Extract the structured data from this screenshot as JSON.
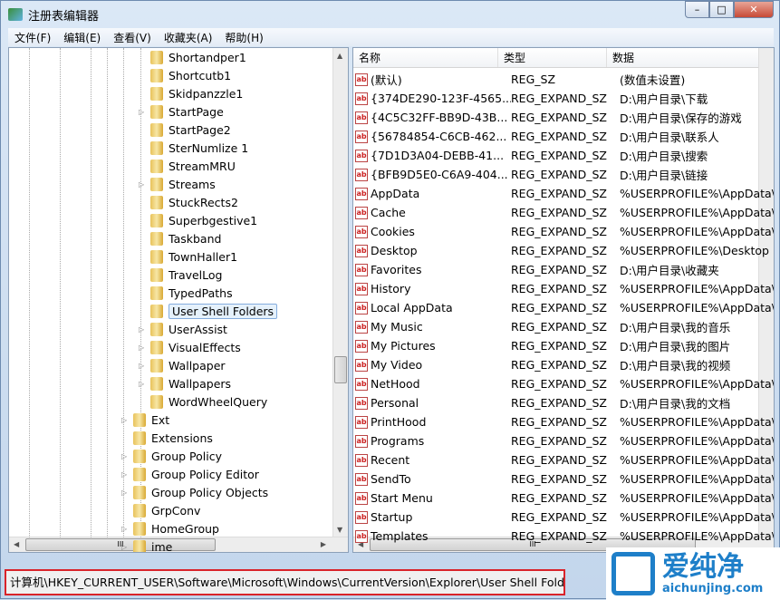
{
  "window": {
    "title": "注册表编辑器",
    "controls": [
      "minimize",
      "maximize",
      "close"
    ]
  },
  "menu": [
    "文件(F)",
    "编辑(E)",
    "查看(V)",
    "收藏夹(A)",
    "帮助(H)"
  ],
  "tree": {
    "deep": [
      {
        "label": "Shortandper1",
        "expandable": false
      },
      {
        "label": "Shortcutb1",
        "expandable": false
      },
      {
        "label": "Skidpanzzle1",
        "expandable": false
      },
      {
        "label": "StartPage",
        "expandable": true
      },
      {
        "label": "StartPage2",
        "expandable": false
      },
      {
        "label": "SterNumlize 1",
        "expandable": false
      },
      {
        "label": "StreamMRU",
        "expandable": false
      },
      {
        "label": "Streams",
        "expandable": true
      },
      {
        "label": "StuckRects2",
        "expandable": false
      },
      {
        "label": "Superbgestive1",
        "expandable": false
      },
      {
        "label": "Taskband",
        "expandable": false
      },
      {
        "label": "TownHaller1",
        "expandable": false
      },
      {
        "label": "TravelLog",
        "expandable": false
      },
      {
        "label": "TypedPaths",
        "expandable": false
      },
      {
        "label": "User Shell Folders",
        "expandable": false,
        "selected": true
      },
      {
        "label": "UserAssist",
        "expandable": true
      },
      {
        "label": "VisualEffects",
        "expandable": true
      },
      {
        "label": "Wallpaper",
        "expandable": true
      },
      {
        "label": "Wallpapers",
        "expandable": true
      },
      {
        "label": "WordWheelQuery",
        "expandable": false
      }
    ],
    "upper": [
      {
        "label": "Ext",
        "expandable": true
      },
      {
        "label": "Extensions",
        "expandable": false
      },
      {
        "label": "Group Policy",
        "expandable": true
      },
      {
        "label": "Group Policy Editor",
        "expandable": true
      },
      {
        "label": "Group Policy Objects",
        "expandable": true
      },
      {
        "label": "GrpConv",
        "expandable": false
      },
      {
        "label": "HomeGroup",
        "expandable": true
      },
      {
        "label": "ime",
        "expandable": true
      }
    ]
  },
  "list": {
    "headers": [
      "名称",
      "类型",
      "数据"
    ],
    "rows": [
      [
        "(默认)",
        "REG_SZ",
        "(数值未设置)"
      ],
      [
        "{374DE290-123F-4565...",
        "REG_EXPAND_SZ",
        "D:\\用户目录\\下载"
      ],
      [
        "{4C5C32FF-BB9D-43B...",
        "REG_EXPAND_SZ",
        "D:\\用户目录\\保存的游戏"
      ],
      [
        "{56784854-C6CB-462...",
        "REG_EXPAND_SZ",
        "D:\\用户目录\\联系人"
      ],
      [
        "{7D1D3A04-DEBB-41...",
        "REG_EXPAND_SZ",
        "D:\\用户目录\\搜索"
      ],
      [
        "{BFB9D5E0-C6A9-404...",
        "REG_EXPAND_SZ",
        "D:\\用户目录\\链接"
      ],
      [
        "AppData",
        "REG_EXPAND_SZ",
        "%USERPROFILE%\\AppData\\Rc"
      ],
      [
        "Cache",
        "REG_EXPAND_SZ",
        "%USERPROFILE%\\AppData\\Lo"
      ],
      [
        "Cookies",
        "REG_EXPAND_SZ",
        "%USERPROFILE%\\AppData\\Rc"
      ],
      [
        "Desktop",
        "REG_EXPAND_SZ",
        "%USERPROFILE%\\Desktop"
      ],
      [
        "Favorites",
        "REG_EXPAND_SZ",
        "D:\\用户目录\\收藏夹"
      ],
      [
        "History",
        "REG_EXPAND_SZ",
        "%USERPROFILE%\\AppData\\Lo"
      ],
      [
        "Local AppData",
        "REG_EXPAND_SZ",
        "%USERPROFILE%\\AppData\\Lo"
      ],
      [
        "My Music",
        "REG_EXPAND_SZ",
        "D:\\用户目录\\我的音乐"
      ],
      [
        "My Pictures",
        "REG_EXPAND_SZ",
        "D:\\用户目录\\我的图片"
      ],
      [
        "My Video",
        "REG_EXPAND_SZ",
        "D:\\用户目录\\我的视频"
      ],
      [
        "NetHood",
        "REG_EXPAND_SZ",
        "%USERPROFILE%\\AppData\\Rc"
      ],
      [
        "Personal",
        "REG_EXPAND_SZ",
        "D:\\用户目录\\我的文档"
      ],
      [
        "PrintHood",
        "REG_EXPAND_SZ",
        "%USERPROFILE%\\AppData\\Rc"
      ],
      [
        "Programs",
        "REG_EXPAND_SZ",
        "%USERPROFILE%\\AppData\\Rc"
      ],
      [
        "Recent",
        "REG_EXPAND_SZ",
        "%USERPROFILE%\\AppData\\Rc"
      ],
      [
        "SendTo",
        "REG_EXPAND_SZ",
        "%USERPROFILE%\\AppData\\Rc"
      ],
      [
        "Start Menu",
        "REG_EXPAND_SZ",
        "%USERPROFILE%\\AppData\\Rc"
      ],
      [
        "Startup",
        "REG_EXPAND_SZ",
        "%USERPROFILE%\\AppData\\Rc"
      ],
      [
        "Templates",
        "REG_EXPAND_SZ",
        "%USERPROFILE%\\AppData\\Rc"
      ]
    ]
  },
  "status": {
    "path": "计算机\\HKEY_CURRENT_USER\\Software\\Microsoft\\Windows\\CurrentVersion\\Explorer\\User Shell Folders"
  },
  "watermark": {
    "title": "爱纯净",
    "url": "aichunjing.com"
  },
  "colors": {
    "highlight": "#d9232a",
    "brand": "#1e7fc9"
  }
}
